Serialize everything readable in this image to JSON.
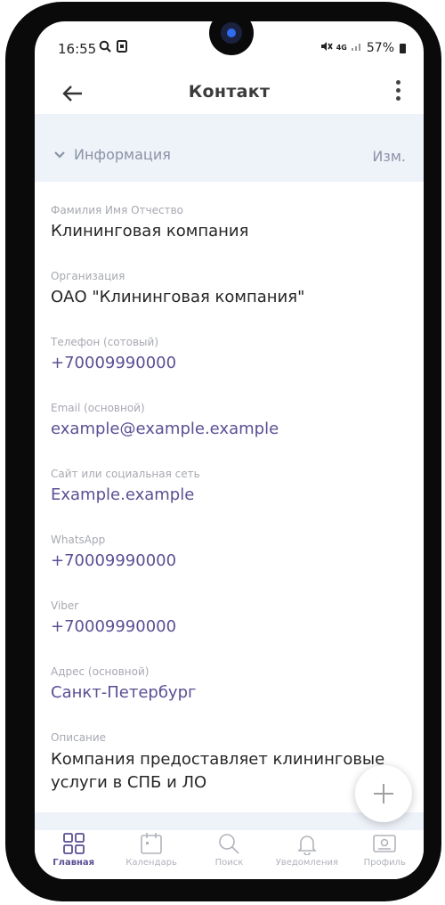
{
  "status_bar": {
    "time": "16:55",
    "network": "4G",
    "battery": "57%"
  },
  "header": {
    "title": "Контакт"
  },
  "section": {
    "title": "Информация",
    "edit_label": "Изм."
  },
  "fields": [
    {
      "label": "Фамилия Имя Отчество",
      "value": "Клининговая компания",
      "link": false
    },
    {
      "label": "Организация",
      "value": "ОАО \"Клининговая компания\"",
      "link": false
    },
    {
      "label": "Телефон  (сотовый)",
      "value": "+70009990000",
      "link": true
    },
    {
      "label": "Email (основной)",
      "value": "example@example.example",
      "link": true
    },
    {
      "label": "Сайт или социальная сеть",
      "value": "Example.example",
      "link": true
    },
    {
      "label": "WhatsApp",
      "value": "+70009990000",
      "link": true
    },
    {
      "label": "Viber",
      "value": "+70009990000",
      "link": true
    },
    {
      "label": "Адрес (основной)",
      "value": "Санкт-Петербург",
      "link": true
    },
    {
      "label": "Описание",
      "value": "Компания предоставляет клининговые услуги в СПБ и ЛО",
      "link": false
    }
  ],
  "fab": {
    "icon": "plus-icon"
  },
  "nav": [
    {
      "label": "Главная",
      "icon": "grid-icon",
      "active": true
    },
    {
      "label": "Календарь",
      "icon": "calendar-icon",
      "active": false
    },
    {
      "label": "Поиск",
      "icon": "search-icon",
      "active": false
    },
    {
      "label": "Уведомления",
      "icon": "bell-icon",
      "active": false
    },
    {
      "label": "Профиль",
      "icon": "profile-icon",
      "active": false
    }
  ],
  "colors": {
    "accent": "#5a4f94",
    "section_bg": "#eef2f9",
    "muted": "#a7a9b1"
  }
}
